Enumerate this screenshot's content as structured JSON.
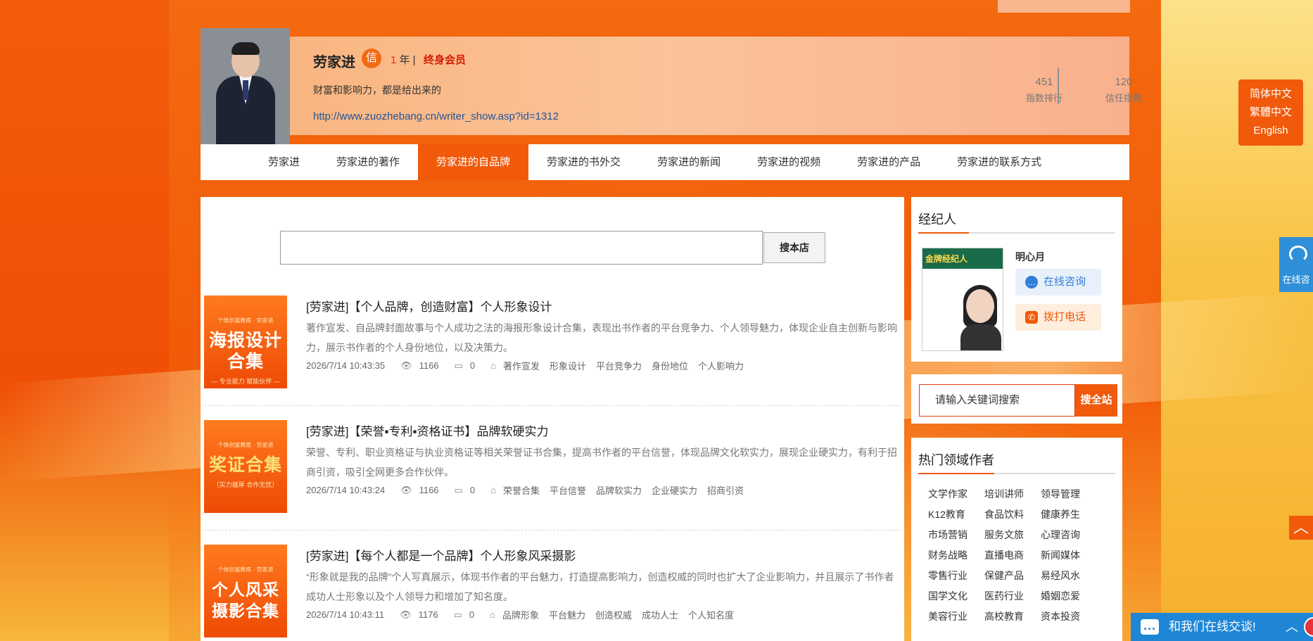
{
  "profile": {
    "name": "劳家进",
    "badge": "信",
    "years_num": "1",
    "years_unit": "年 |",
    "membership": "终身会员",
    "motto": "财富和影响力，都是给出来的",
    "link": "http://www.zuozhebang.cn/writer_show.asp?id=1312",
    "stat1_value": "451",
    "stat1_label": "指数排行",
    "stat2_value": "120",
    "stat2_label": "信任指数"
  },
  "nav": {
    "items": [
      {
        "label": "劳家进"
      },
      {
        "label": "劳家进的著作"
      },
      {
        "label": "劳家进的自品牌"
      },
      {
        "label": "劳家进的书外交"
      },
      {
        "label": "劳家进的新闻"
      },
      {
        "label": "劳家进的视频"
      },
      {
        "label": "劳家进的产品"
      },
      {
        "label": "劳家进的联系方式"
      }
    ],
    "active_index": 2
  },
  "store_search": {
    "placeholder": "",
    "button": "搜本店"
  },
  "articles": [
    {
      "thumb_tag": "个体创富教练 · 劳家进",
      "thumb_title": "海报设计合集",
      "thumb_sub": "— 专业能力 赋能伙伴 —",
      "title": "[劳家进]【个人品牌，创造财富】个人形象设计",
      "desc": "著作宣发、自品牌封面故事与个人成功之法的海报形象设计合集，表现出书作者的平台竞争力、个人领导魅力，体现企业自主创新与影响力，展示书作者的个人身份地位，以及决策力。",
      "date": "2026/7/14 10:43:35",
      "views": "1166",
      "comments": "0",
      "keywords": [
        "著作宣发",
        "形象设计",
        "平台竞争力",
        "身份地位",
        "个人影响力"
      ]
    },
    {
      "thumb_tag": "个体创富教练 · 劳家进",
      "thumb_title": "奖证合集",
      "thumb_sub": "〔实力雄厚 合作无忧〕",
      "title": "[劳家进]【荣誉▪专利▪资格证书】品牌软硬实力",
      "desc": "荣誉、专利、职业资格证与执业资格证等相关荣誉证书合集，提高书作者的平台信誉，体现品牌文化软实力，展现企业硬实力，有利于招商引资，吸引全网更多合作伙伴。",
      "date": "2026/7/14 10:43:24",
      "views": "1166",
      "comments": "0",
      "keywords": [
        "荣誉合集",
        "平台信誉",
        "品牌软实力",
        "企业硬实力",
        "招商引资"
      ]
    },
    {
      "thumb_tag": "个体创富教练 · 劳家进",
      "thumb_title": "个人风采摄影合集",
      "thumb_sub": "",
      "title": "[劳家进]【每个人都是一个品牌】个人形象风采摄影",
      "desc": "“形象就是我的品牌”个人写真展示，体现书作者的平台魅力，打造提高影响力，创造权威的同时也扩大了企业影响力，并且展示了书作者成功人士形象以及个人领导力和增加了知名度。",
      "date": "2026/7/14 10:43:11",
      "views": "1176",
      "comments": "0",
      "keywords": [
        "品牌形象",
        "平台魅力",
        "创造权威",
        "成功人士",
        "个人知名度"
      ]
    }
  ],
  "agent": {
    "heading": "经纪人",
    "poster_title": "金牌经纪人",
    "name": "明心月",
    "chat_button": "在线咨询",
    "call_button": "拨打电话"
  },
  "site_search": {
    "placeholder": "请输入关键词搜索",
    "button": "搜全站"
  },
  "hot_authors": {
    "heading": "热门领域作者",
    "items": [
      "文学作家",
      "培训讲师",
      "领导管理",
      "K12教育",
      "食品饮料",
      "健康养生",
      "市场营销",
      "服务文旅",
      "心理咨询",
      "财务战略",
      "直播电商",
      "新闻媒体",
      "零售行业",
      "保健产品",
      "易经风水",
      "国学文化",
      "医药行业",
      "婚姻恋爱",
      "美容行业",
      "高校教育",
      "资本投资"
    ]
  },
  "language": {
    "simplified": "简体中文",
    "traditional": "繁體中文",
    "english": "English"
  },
  "floating": {
    "online_label": "在线咨",
    "chat_bar": "和我们在线交谈!",
    "caret": "︿",
    "totop": "︿"
  },
  "colors": {
    "accent": "#f05a0a",
    "link": "#225599",
    "chat_blue": "#1f86d6"
  }
}
